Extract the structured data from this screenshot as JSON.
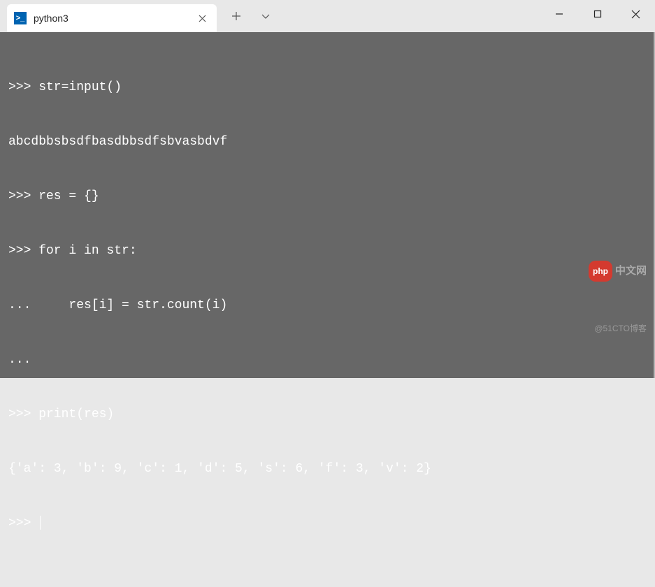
{
  "tab": {
    "title": "python3",
    "icon_glyph": ">_"
  },
  "terminal": {
    "lines": [
      ">>> str=input()",
      "abcdbbsbsdfbasdbbsdfsbvasbdvf",
      ">>> res = {}",
      ">>> for i in str:",
      "...     res[i] = str.count(i)",
      "...",
      ">>> print(res)",
      "{'a': 3, 'b': 9, 'c': 1, 'd': 5, 's': 6, 'f': 3, 'v': 2}",
      ">>> "
    ]
  },
  "watermark": {
    "badge": "php",
    "text1": "中文网",
    "text2": "@51CTO博客"
  }
}
